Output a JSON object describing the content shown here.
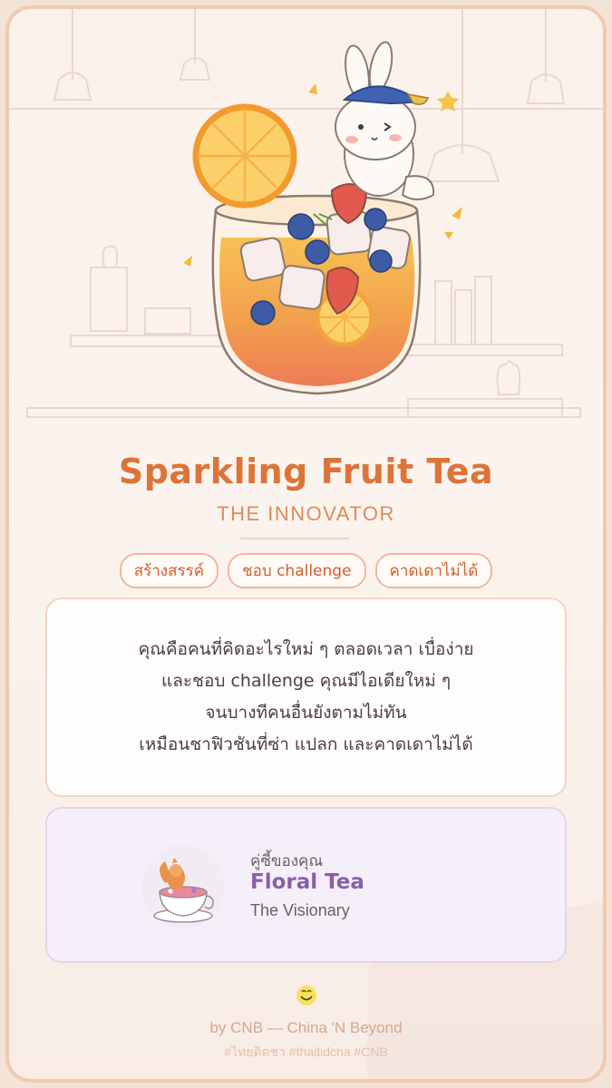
{
  "result": {
    "drink_name": "Sparkling Fruit Tea",
    "persona": "THE INNOVATOR",
    "tags": [
      "สร้างสรรค์",
      "ชอบ challenge",
      "คาดเดาไม่ได้"
    ],
    "description_lines": [
      "คุณคือคนที่คิดอะไรใหม่ ๆ ตลอดเวลา เบื่อง่าย",
      "และชอบ challenge คุณมีไอเดียใหม่ ๆ",
      "จนบางทีคนอื่นยังตามไม่ทัน",
      "เหมือนชาฟิวชันที่ซ่า แปลก และคาดเดาไม่ได้"
    ]
  },
  "match": {
    "label": "คู่ซี้ของคุณ",
    "name": "Floral Tea",
    "role": "The Visionary"
  },
  "footer": {
    "byline": "by CNB — China 'N Beyond",
    "hashtags": "#ไทยติดชา #thaitidcha #CNB"
  },
  "colors": {
    "title": "#dc7438",
    "tag_border": "#f0b89a",
    "match_name": "#8a5fa8",
    "frame": "#f1c9ae"
  },
  "icons": {
    "hero": "sparkling-fruit-tea-bunny-illustration",
    "match": "floral-tea-cup-illustration",
    "logo": "smiley-logo-icon"
  }
}
